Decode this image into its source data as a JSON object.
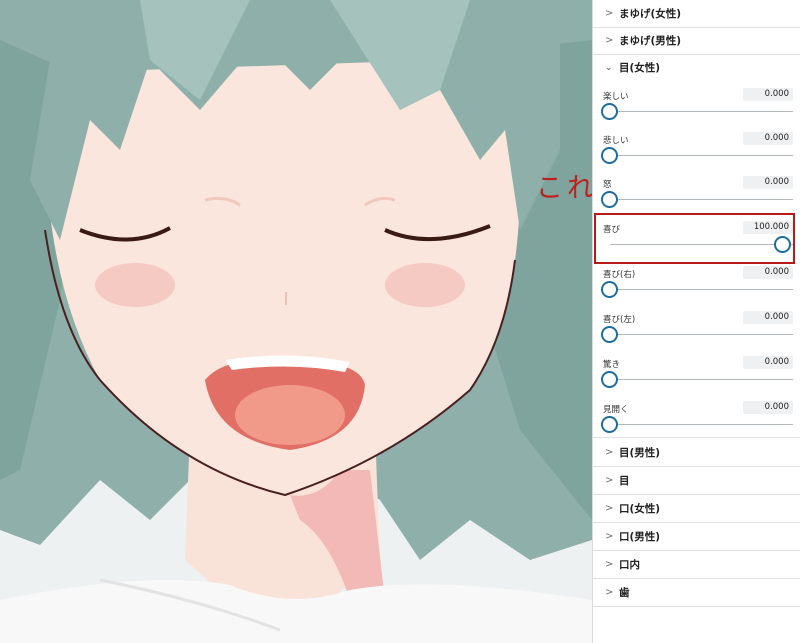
{
  "annotation": {
    "text": "これを",
    "color": "#c0201c"
  },
  "panel": {
    "sections_top": [
      {
        "label": "まゆげ(女性)",
        "expanded": false
      },
      {
        "label": "まゆげ(男性)",
        "expanded": false
      }
    ],
    "expanded_section": {
      "label": "目(女性)",
      "sliders": [
        {
          "label": "楽しい",
          "value": "0.000",
          "fraction": 0
        },
        {
          "label": "悲しい",
          "value": "0.000",
          "fraction": 0
        },
        {
          "label": "怒",
          "value": "0.000",
          "fraction": 0
        },
        {
          "label": "喜び",
          "value": "100.000",
          "fraction": 1
        },
        {
          "label": "喜び(右)",
          "value": "0.000",
          "fraction": 0
        },
        {
          "label": "喜び(左)",
          "value": "0.000",
          "fraction": 0
        },
        {
          "label": "驚き",
          "value": "0.000",
          "fraction": 0
        },
        {
          "label": "見開く",
          "value": "0.000",
          "fraction": 0
        }
      ]
    },
    "sections_bottom": [
      {
        "label": "目(男性)",
        "expanded": false
      },
      {
        "label": "目",
        "expanded": false
      },
      {
        "label": "口(女性)",
        "expanded": false
      },
      {
        "label": "口(男性)",
        "expanded": false
      },
      {
        "label": "口内",
        "expanded": false
      },
      {
        "label": "歯",
        "expanded": false
      }
    ]
  },
  "colors": {
    "hair": "#8fb0aa",
    "skin": "#fae6dc",
    "accent": "#1d6e9e",
    "highlight": "#b81a1a"
  },
  "icons": {
    "collapsed": "chevron-right-icon",
    "expanded": "chevron-down-icon"
  }
}
